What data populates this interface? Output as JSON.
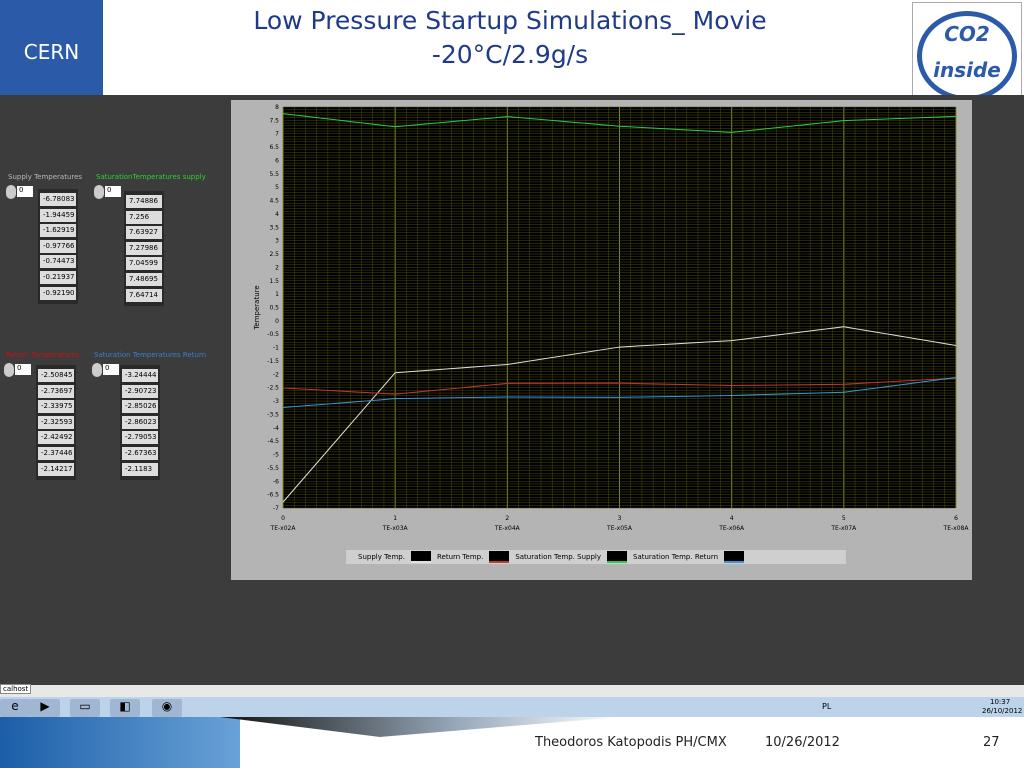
{
  "slide": {
    "title_line1": "Low Pressure Startup Simulations_ Movie",
    "title_line2": "-20°C/2.9g/s",
    "logo_left": "CERN",
    "logo_right": "CO2 inside",
    "footer_author": "Theodoros Katopodis PH/CMX",
    "footer_date": "10/26/2012",
    "page_number": "27"
  },
  "arrays": [
    {
      "label": "Supply Temperatures",
      "color": "#b8b8b8",
      "index": "0",
      "values": [
        "-6.78083",
        "-1.94459",
        "-1.62919",
        "-0.97766",
        "-0.74473",
        "-0.21937",
        "-0.92190"
      ]
    },
    {
      "label": "SaturationTemperatures supply",
      "color": "#33cc33",
      "index": "0",
      "values": [
        "7.74886",
        "7.256",
        "7.63927",
        "7.27986",
        "7.04599",
        "7.48695",
        "7.64714"
      ]
    },
    {
      "label": "Return Temperatures",
      "color": "#cc1111",
      "index": "0",
      "values": [
        "-2.50845",
        "-2.73697",
        "-2.33975",
        "-2.32593",
        "-2.42492",
        "-2.37446",
        "-2.14217"
      ]
    },
    {
      "label": "Saturation Temperatures Return",
      "color": "#3a7fd0",
      "index": "0",
      "values": [
        "-3.24444",
        "-2.90723",
        "-2.85026",
        "-2.86023",
        "-2.79053",
        "-2.67363",
        "-2.1183"
      ]
    }
  ],
  "chart_data": {
    "type": "line",
    "ylabel": "Temperature",
    "ylim": [
      -7,
      8
    ],
    "ytick_step": 0.5,
    "x": [
      0,
      1,
      2,
      3,
      4,
      5,
      6
    ],
    "categories": [
      "TE-x02A",
      "TE-x03A",
      "TE-x04A",
      "TE-x05A",
      "TE-x06A",
      "TE-x07A",
      "TE-x08A"
    ],
    "series": [
      {
        "name": "Supply Temp.",
        "color": "#e0e0e0",
        "values": [
          -6.78,
          -1.94,
          -1.63,
          -0.98,
          -0.74,
          -0.22,
          -0.92
        ]
      },
      {
        "name": "Return Temp.",
        "color": "#c0392b",
        "values": [
          -2.51,
          -2.74,
          -2.34,
          -2.33,
          -2.42,
          -2.37,
          -2.14
        ]
      },
      {
        "name": "Saturation Temp. Supply",
        "color": "#2ecc40",
        "values": [
          7.75,
          7.26,
          7.64,
          7.28,
          7.05,
          7.49,
          7.65
        ]
      },
      {
        "name": "Saturation Temp. Return",
        "color": "#3498db",
        "values": [
          -3.24,
          -2.91,
          -2.85,
          -2.86,
          -2.79,
          -2.67,
          -2.12
        ]
      }
    ]
  },
  "taskbar": {
    "address": "calhost",
    "lang": "PL",
    "time": "10:37",
    "date": "26/10/2012"
  }
}
